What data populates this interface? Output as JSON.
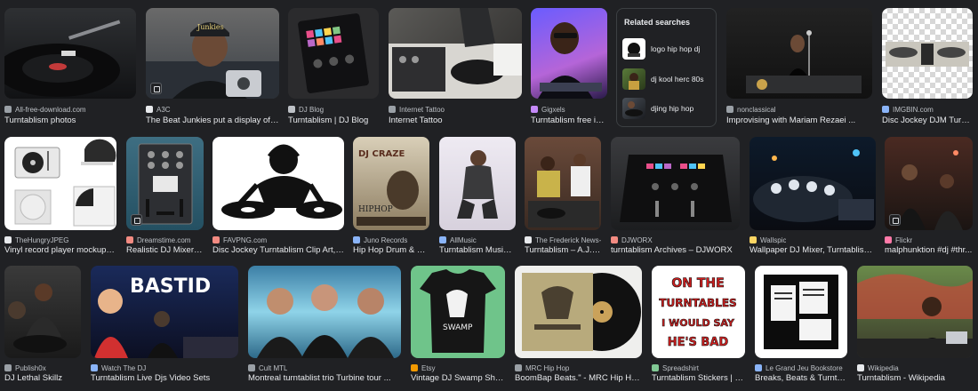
{
  "results": [
    {
      "source": "All-free-download.com",
      "title": "Turntablism photos",
      "fav": "#9aa0a6"
    },
    {
      "source": "A3C",
      "title": "The Beat Junkies put a display of tru...",
      "fav": "#e8eaed"
    },
    {
      "source": "DJ Blog",
      "title": "Turntablism | DJ Blog",
      "fav": "#bdc1c6"
    },
    {
      "source": "Internet Tattoo",
      "title": "Internet Tattoo",
      "fav": "#9aa0a6"
    },
    {
      "source": "Gigxels",
      "title": "Turntablism free im...",
      "fav": "#c58af9"
    },
    {
      "source": "nonclassical",
      "title": "Improvising with Mariam Rezaei ...",
      "fav": "#9aa0a6"
    },
    {
      "source": "IMGBIN.com",
      "title": "Disc Jockey DJM Turnta...",
      "fav": "#8ab4f8"
    },
    {
      "source": "TheHungryJPEG",
      "title": "Vinyl record player mockup. Re...",
      "fav": "#e8eaed"
    },
    {
      "source": "Dreamstime.com",
      "title": "Realistic DJ Mixer f...",
      "fav": "#f28b82"
    },
    {
      "source": "FAVPNG.com",
      "title": "Disc Jockey Turntablism Clip Art, P...",
      "fav": "#f28b82"
    },
    {
      "source": "Juno Records",
      "title": "Hip Hop Drum & Ba...",
      "fav": "#8ab4f8"
    },
    {
      "source": "AllMusic",
      "title": "Turntablism Music ...",
      "fav": "#8ab4f8"
    },
    {
      "source": "The Frederick News-...",
      "title": "Turntablism – A.J. ...",
      "fav": "#e8eaed"
    },
    {
      "source": "DJWORX",
      "title": "turntablism Archives – DJWORX",
      "fav": "#f28b82"
    },
    {
      "source": "Wallspic",
      "title": "Wallpaper DJ Mixer, Turntablism, Di...",
      "fav": "#fdd663"
    },
    {
      "source": "Flickr",
      "title": "malphunktion #dj #thr...",
      "fav": "#ff7aa8"
    },
    {
      "source": "Publish0x",
      "title": "DJ Lethal Skillz",
      "fav": "#9aa0a6"
    },
    {
      "source": "Watch The DJ",
      "title": "Turntablism Live Djs Video Sets",
      "fav": "#8ab4f8"
    },
    {
      "source": "Cult MTL",
      "title": "Montreal turntablist trio Turbine tour ...",
      "fav": "#9aa0a6"
    },
    {
      "source": "Etsy",
      "title": "Vintage DJ Swamp Shirt ...",
      "fav": "#f29900"
    },
    {
      "source": "MRC Hip Hop",
      "title": "BoomBap Beats.\" - MRC Hip Hop ...",
      "fav": "#9aa0a6"
    },
    {
      "source": "Spreadshirt",
      "title": "Turntablism Stickers | Un...",
      "fav": "#81c995"
    },
    {
      "source": "Le Grand Jeu Bookstore",
      "title": "Breaks, Beats & Turntabli...",
      "fav": "#8ab4f8"
    },
    {
      "source": "Wikipedia",
      "title": "Turntablism - Wikipedia",
      "fav": "#e8eaed"
    }
  ],
  "thumb_text": {
    "cap": "Junkies",
    "dj_craze": "DJ CRAZE",
    "hiphop": "HIPHOP",
    "swamp": "SWAMP",
    "bastid": "BASTID",
    "sticker": [
      "ON THE",
      "TURNTABLES",
      "I WOULD SAY",
      "HE'S BAD"
    ]
  },
  "related": {
    "heading": "Related searches",
    "items": [
      {
        "label": "logo hip hop dj"
      },
      {
        "label": "dj kool herc 80s"
      },
      {
        "label": "djing hip hop"
      }
    ]
  }
}
